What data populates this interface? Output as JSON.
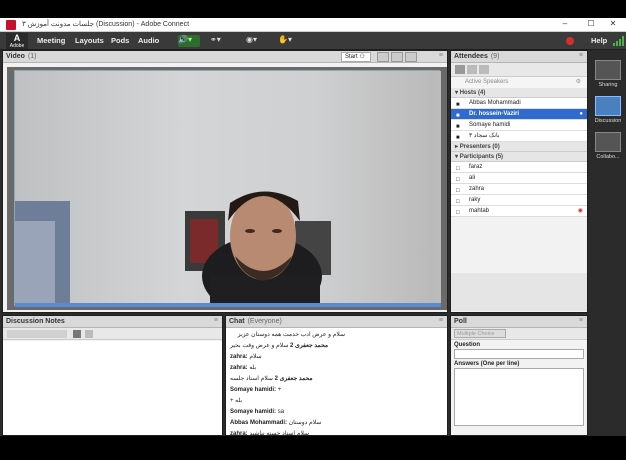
{
  "window": {
    "title": "جلسات مدونت آموزش ۳ (Discussion) - Adobe Connect",
    "controls": [
      "–",
      "☐",
      "✕"
    ]
  },
  "menubar": {
    "logo": "Adobe",
    "items": [
      "Meeting",
      "Layouts",
      "Pods",
      "Audio"
    ],
    "help": "Help"
  },
  "video_pod": {
    "title": "Video",
    "count": "(1)",
    "start_label": "Start",
    "options": "≡"
  },
  "attendees_pod": {
    "title": "Attendees",
    "count": "(9)",
    "active_speakers": "Active Speakers",
    "hosts_header": "Hosts (4)",
    "hosts": [
      "Abbas Mohammadi",
      "Dr. hossein-Vaziri",
      "Somaye hamidi",
      "بانک سجاد ۳"
    ],
    "selected_host_index": 1,
    "presenters_header": "Presenters (0)",
    "participants_header": "Participants (5)",
    "participants": [
      "faraz",
      "ali",
      "zahra",
      "raky",
      "mahtab"
    ]
  },
  "layouts": [
    {
      "label": "Sharing",
      "active": false
    },
    {
      "label": "Discussion",
      "active": true
    },
    {
      "label": "Collabo...",
      "active": false
    }
  ],
  "notes_pod": {
    "title": "Discussion Notes"
  },
  "chat_pod": {
    "title": "Chat",
    "subtitle": "(Everyone)",
    "messages": [
      {
        "name": "",
        "text": "سلام و عرض ادب خدمت همه دوستان عزیز"
      },
      {
        "name": "محمد جعفری 2",
        "text": "سلام و عرض وقت بخیر"
      },
      {
        "name": "zahra:",
        "text": "سلام"
      },
      {
        "name": "zahra:",
        "text": "بله"
      },
      {
        "name": "محمد جعفری 2",
        "text": "سلام استاد جلسه"
      },
      {
        "name": "Somaye hamidi:",
        "text": "+"
      },
      {
        "name": "",
        "text": "+ بله"
      },
      {
        "name": "Somaye hamidi:",
        "text": "sa"
      },
      {
        "name": "Abbas Mohammadi:",
        "text": "سلام دوستان"
      },
      {
        "name": "zahra:",
        "text": "سلام استاد خسته نباشید"
      }
    ]
  },
  "poll_pod": {
    "title": "Poll",
    "dropdown": "Multiple Choice",
    "question_label": "Question",
    "answers_label": "Answers (One per line)"
  }
}
